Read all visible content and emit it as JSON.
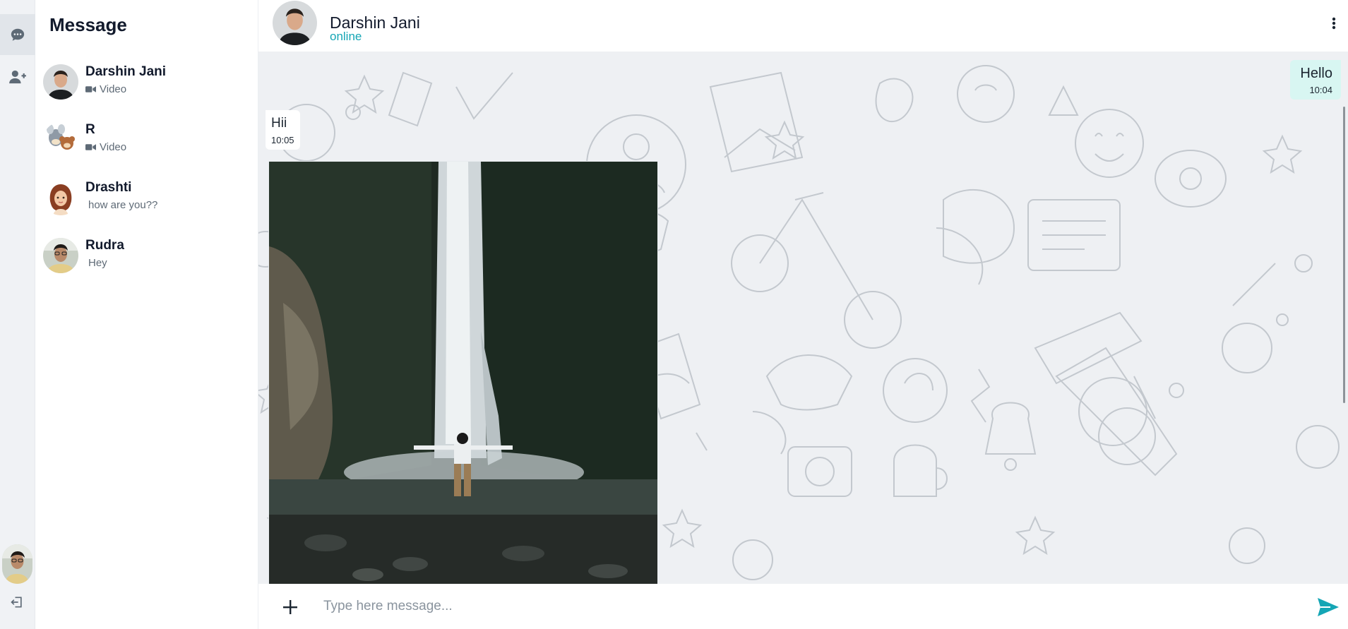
{
  "sidebar": {
    "title": "Message",
    "contacts": [
      {
        "name": "Darshin Jani",
        "preview": "Video",
        "preview_icon": "video-icon"
      },
      {
        "name": "R",
        "preview": "Video",
        "preview_icon": "video-icon"
      },
      {
        "name": "Drashti",
        "preview": "how are you??"
      },
      {
        "name": "Rudra",
        "preview": "Hey"
      }
    ]
  },
  "rail": {
    "icons": [
      "chat-icon",
      "add-user-icon",
      "logout-icon"
    ]
  },
  "header": {
    "name": "Darshin Jani",
    "status": "online"
  },
  "messages": {
    "outgoing": {
      "text": "Hello",
      "time": "10:04"
    },
    "incoming": {
      "text": "Hii",
      "time": "10:05"
    }
  },
  "composer": {
    "placeholder": "Type here message..."
  },
  "colors": {
    "accent": "#15a6b5",
    "outgoing_bubble": "#d8f6f2",
    "rail_bg": "#f0f2f5",
    "chat_bg": "#eef0f3"
  }
}
